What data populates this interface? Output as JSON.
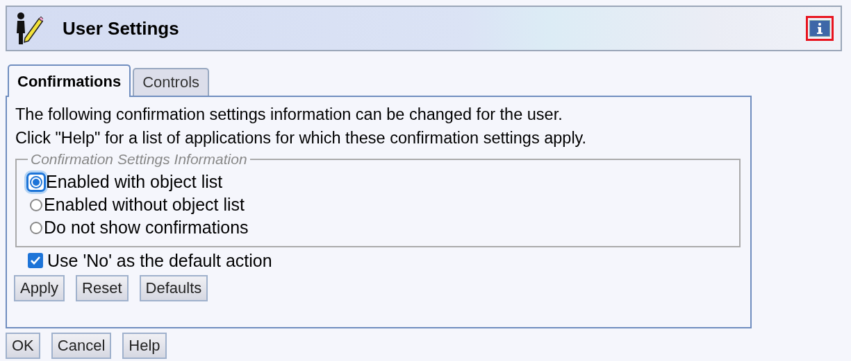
{
  "header": {
    "title": "User Settings",
    "info_button": {
      "highlighted": true
    }
  },
  "tabs": [
    {
      "label": "Confirmations",
      "selected": true
    },
    {
      "label": "Controls",
      "selected": false
    }
  ],
  "panel": {
    "description": [
      "The following confirmation settings information can be changed for the user.",
      "Click \"Help\" for a list of applications for which these confirmation settings apply."
    ],
    "group": {
      "legend": "Confirmation Settings Information",
      "options": [
        {
          "label": "Enabled with object list",
          "selected": true
        },
        {
          "label": "Enabled without object list",
          "selected": false
        },
        {
          "label": "Do not show confirmations",
          "selected": false
        }
      ]
    },
    "checkbox": {
      "label": "Use 'No' as the default action",
      "checked": true
    },
    "buttons": [
      "Apply",
      "Reset",
      "Defaults"
    ]
  },
  "footer_buttons": [
    "OK",
    "Cancel",
    "Help"
  ]
}
